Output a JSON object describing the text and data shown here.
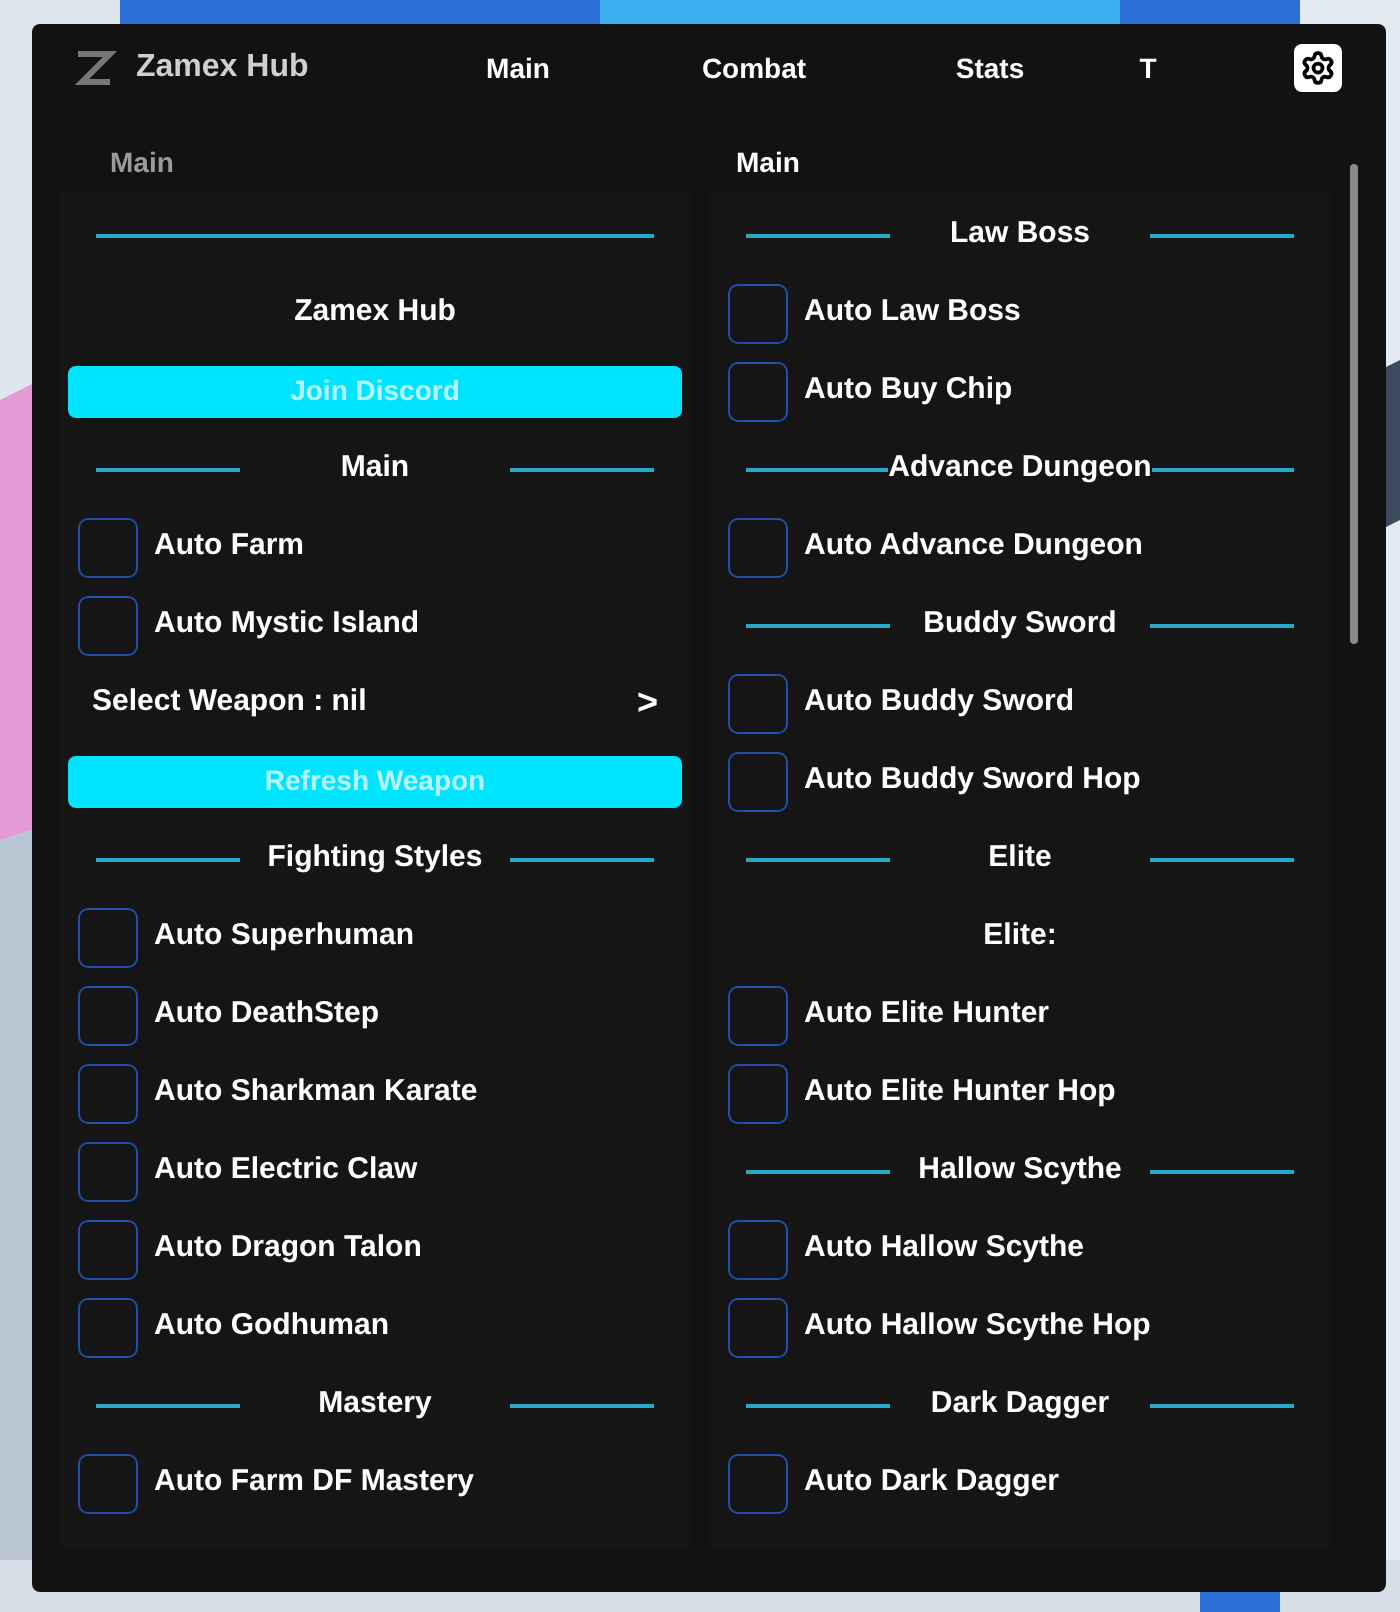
{
  "window": {
    "title": "Zamex Hub"
  },
  "tabs": [
    {
      "label": "Main"
    },
    {
      "label": "Combat"
    },
    {
      "label": "Stats"
    },
    {
      "label": "T"
    }
  ],
  "columns": [
    {
      "title": "Main",
      "items": [
        {
          "kind": "divider"
        },
        {
          "kind": "label",
          "text": "Zamex Hub"
        },
        {
          "kind": "button",
          "text": "Join Discord"
        },
        {
          "kind": "section",
          "text": "Main"
        },
        {
          "kind": "toggle",
          "text": "Auto Farm",
          "checked": false
        },
        {
          "kind": "toggle",
          "text": "Auto Mystic Island",
          "checked": false
        },
        {
          "kind": "dropdown",
          "text": "Select Weapon : nil",
          "arrow": ">"
        },
        {
          "kind": "button",
          "text": "Refresh Weapon"
        },
        {
          "kind": "section",
          "text": "Fighting Styles"
        },
        {
          "kind": "toggle",
          "text": "Auto Superhuman",
          "checked": false
        },
        {
          "kind": "toggle",
          "text": "Auto DeathStep",
          "checked": false
        },
        {
          "kind": "toggle",
          "text": "Auto Sharkman Karate",
          "checked": false
        },
        {
          "kind": "toggle",
          "text": "Auto Electric Claw",
          "checked": false
        },
        {
          "kind": "toggle",
          "text": "Auto Dragon Talon",
          "checked": false
        },
        {
          "kind": "toggle",
          "text": "Auto Godhuman",
          "checked": false
        },
        {
          "kind": "section",
          "text": "Mastery"
        },
        {
          "kind": "toggle",
          "text": "Auto Farm DF Mastery",
          "checked": false
        }
      ]
    },
    {
      "title": "Main",
      "items": [
        {
          "kind": "section",
          "text": "Law Boss"
        },
        {
          "kind": "toggle",
          "text": "Auto Law Boss",
          "checked": false
        },
        {
          "kind": "toggle",
          "text": "Auto Buy Chip",
          "checked": false
        },
        {
          "kind": "section",
          "text": "Advance Dungeon"
        },
        {
          "kind": "toggle",
          "text": "Auto Advance Dungeon",
          "checked": false
        },
        {
          "kind": "section",
          "text": "Buddy Sword"
        },
        {
          "kind": "toggle",
          "text": "Auto Buddy Sword",
          "checked": false
        },
        {
          "kind": "toggle",
          "text": "Auto Buddy Sword Hop",
          "checked": false
        },
        {
          "kind": "section",
          "text": "Elite"
        },
        {
          "kind": "label",
          "text": "Elite:"
        },
        {
          "kind": "toggle",
          "text": "Auto Elite Hunter",
          "checked": false
        },
        {
          "kind": "toggle",
          "text": "Auto Elite Hunter Hop",
          "checked": false
        },
        {
          "kind": "section",
          "text": "Hallow Scythe"
        },
        {
          "kind": "toggle",
          "text": "Auto Hallow Scythe",
          "checked": false
        },
        {
          "kind": "toggle",
          "text": "Auto Hallow Scythe Hop",
          "checked": false
        },
        {
          "kind": "section",
          "text": "Dark Dagger"
        },
        {
          "kind": "toggle",
          "text": "Auto Dark Dagger",
          "checked": false
        }
      ]
    }
  ]
}
